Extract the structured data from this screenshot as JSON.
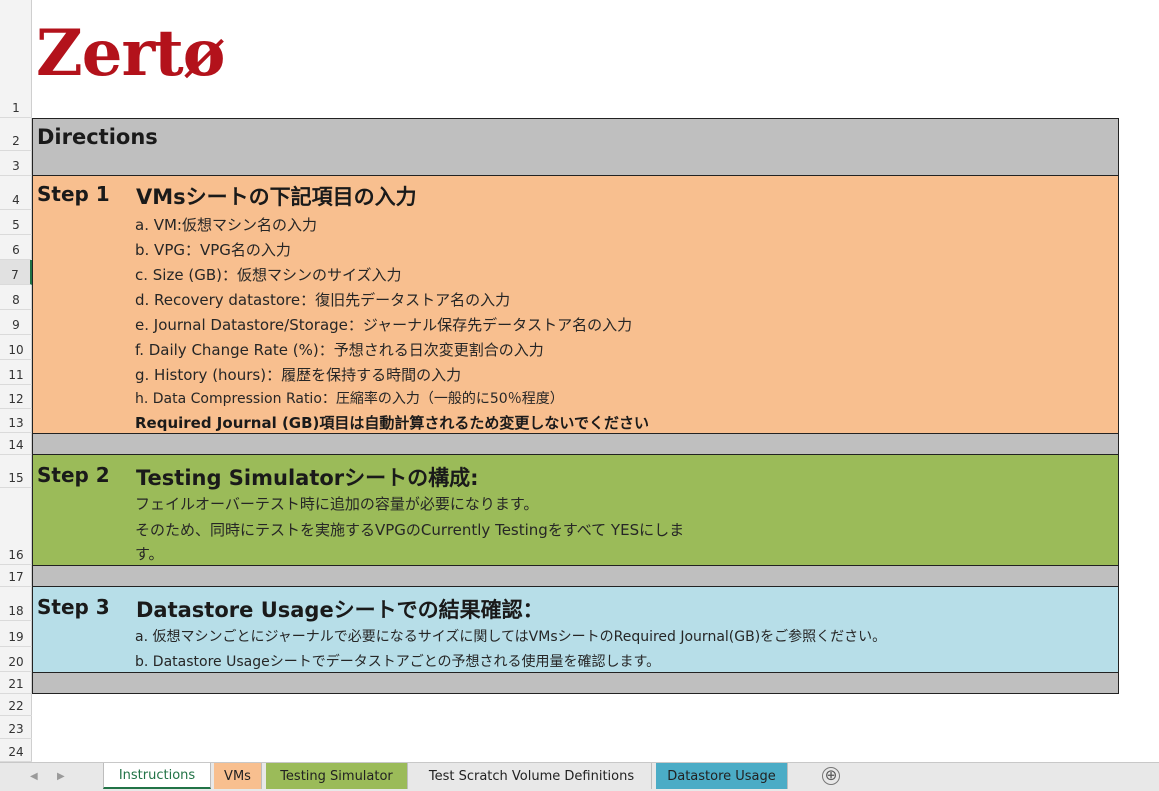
{
  "logo": "Zertø",
  "rows": [
    "1",
    "2",
    "3",
    "4",
    "5",
    "6",
    "7",
    "8",
    "9",
    "10",
    "11",
    "12",
    "13",
    "14",
    "15",
    "16",
    "17",
    "18",
    "19",
    "20",
    "21",
    "22",
    "23",
    "24"
  ],
  "directions": "Directions",
  "step1": {
    "label": "Step 1",
    "title": "VMsシートの下記項目の入力",
    "items": [
      "a.   VM:仮想マシン名の入力",
      "b.   VPG：VPG名の入力",
      "c.   Size (GB)：仮想マシンのサイズ入力",
      "d.   Recovery datastore：復旧先データストア名の入力",
      "e.   Journal Datastore/Storage：ジャーナル保存先データストア名の入力",
      "f.   Daily Change Rate (%)：予想される日次変更割合の入力",
      "g.   History (hours)：履歴を保持する時間の入力",
      "h.  Data Compression Ratio：圧縮率の入力（一般的に50％程度）"
    ],
    "note": "Required Journal (GB)項目は自動計算されるため変更しないでください"
  },
  "step2": {
    "label": "Step 2",
    "title": "Testing Simulatorシートの構成:",
    "lines": [
      "フェイルオーバーテスト時に追加の容量が必要になります。",
      "そのため、同時にテストを実施するVPGのCurrently Testingをすべて YESにしま",
      "す。"
    ]
  },
  "step3": {
    "label": "Step 3",
    "title": "Datastore Usageシートでの結果確認：",
    "items": [
      "a.     仮想マシンごとにジャーナルで必要になるサイズに関してはVMsシートのRequired Journal(GB)をご参照ください。",
      "b.   Datastore Usageシートでデータストアごとの予想される使用量を確認します。"
    ]
  },
  "tabs": {
    "instructions": "Instructions",
    "vms": "VMs",
    "testing_simulator": "Testing Simulator",
    "scratch": "Test Scratch Volume Definitions",
    "datastore_usage": "Datastore Usage",
    "add": "⊕"
  },
  "colors": {
    "logo": "#b3121b",
    "gray_band": "#bfbfbf",
    "step1_band": "#f8bf8f",
    "step2_band": "#9bbb59",
    "step3_band": "#b7dee8",
    "tab_vms": "#f8bf8f",
    "tab_testing": "#9bbb59",
    "tab_datastore": "#4bacc6"
  }
}
